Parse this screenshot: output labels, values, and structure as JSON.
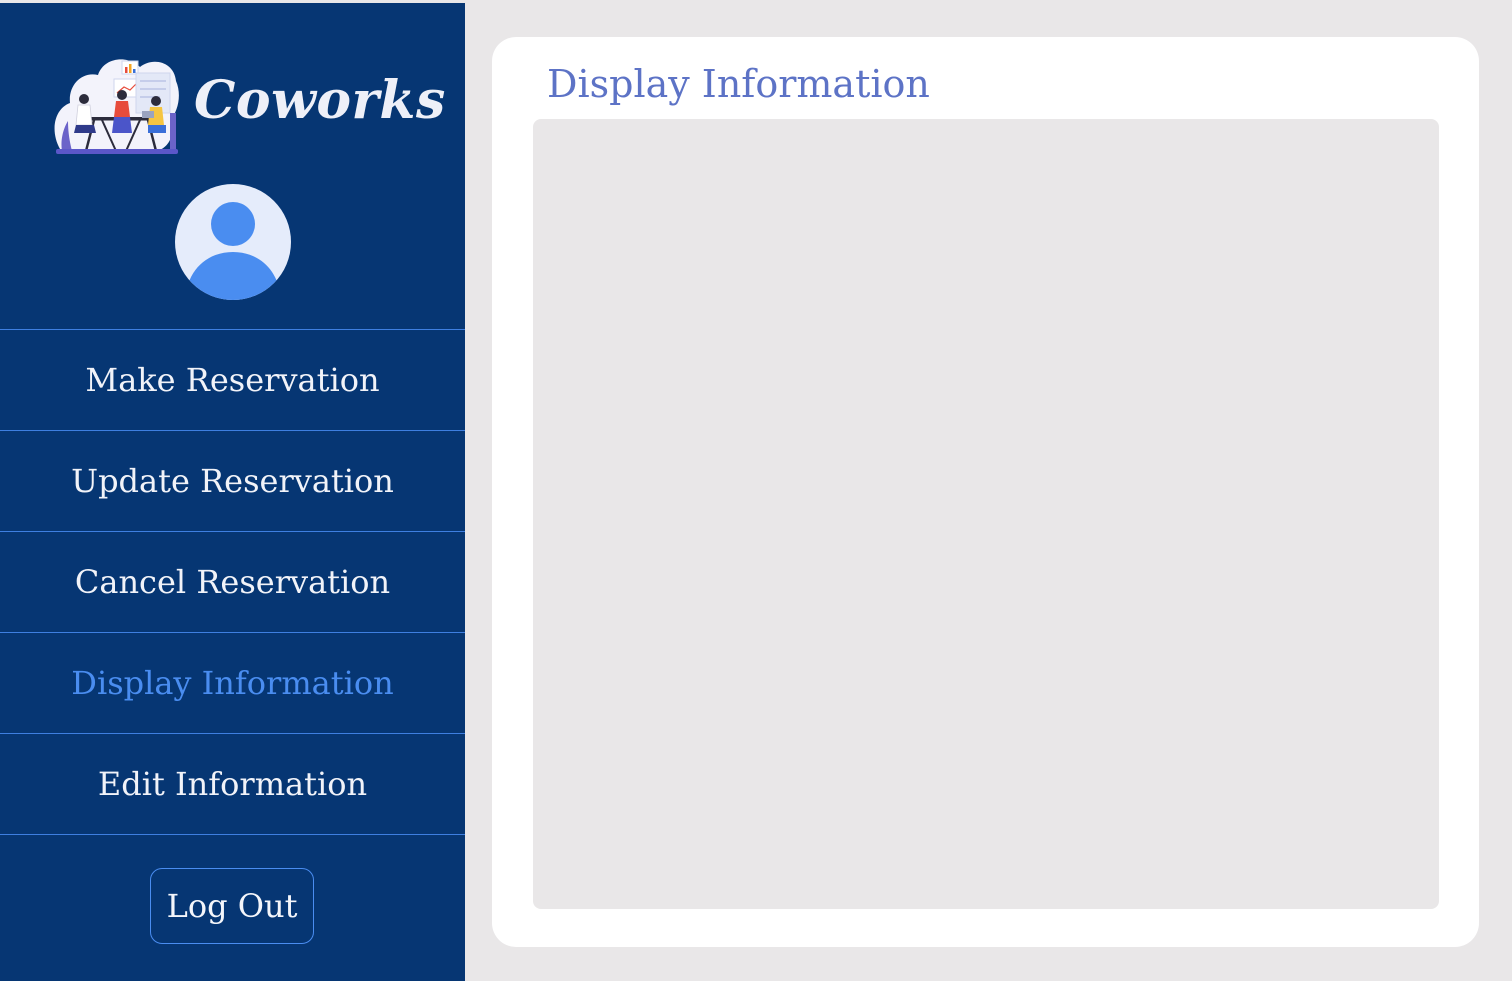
{
  "brand": {
    "name": "Coworks",
    "logo_icon": "coworking-illustration-icon"
  },
  "profile": {
    "avatar_icon": "user-avatar-icon"
  },
  "nav": {
    "items": [
      {
        "label": "Make Reservation"
      },
      {
        "label": "Update Reservation"
      },
      {
        "label": "Cancel Reservation"
      },
      {
        "label": "Display Information",
        "active": true
      },
      {
        "label": "Edit Information"
      }
    ],
    "logout_label": "Log Out"
  },
  "main": {
    "title": "Display Information"
  },
  "colors": {
    "sidebar_bg": "#063673",
    "accent": "#4a8df0",
    "title": "#5d73c6",
    "page_bg": "#e9e7e8"
  }
}
